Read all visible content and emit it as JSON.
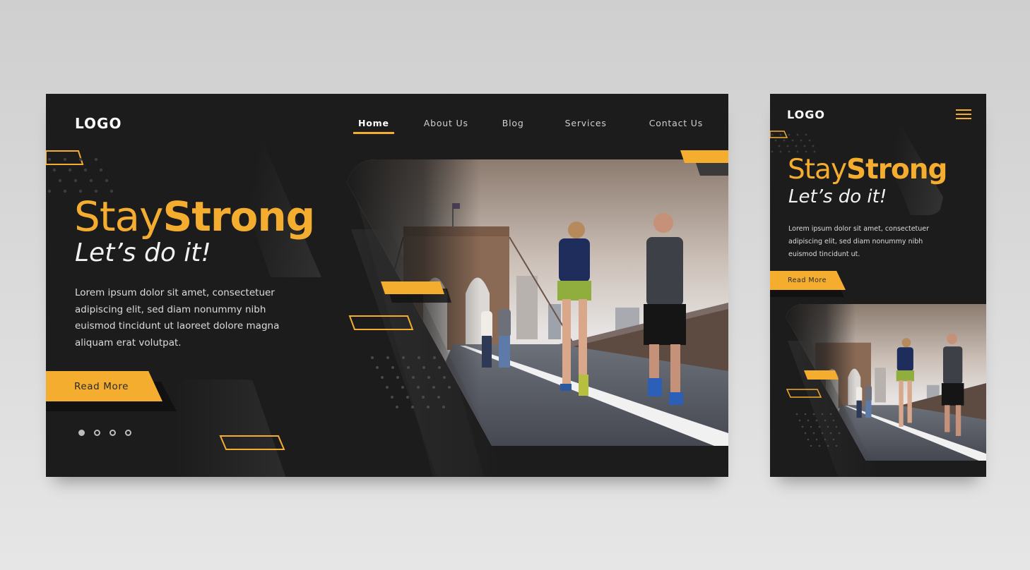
{
  "colors": {
    "accent": "#f5ad30",
    "panel_bg": "#1c1c1c",
    "canvas_bg": "#d8d8d8",
    "text_light": "#dcdcdc"
  },
  "desktop": {
    "logo": "LOGO",
    "nav": [
      {
        "label": "Home",
        "active": true
      },
      {
        "label": "About Us",
        "active": false
      },
      {
        "label": "Blog",
        "active": false
      },
      {
        "label": "Services",
        "active": false
      },
      {
        "label": "Contact Us",
        "active": false
      }
    ],
    "hero": {
      "title_light": "Stay",
      "title_bold": "Strong",
      "subtitle": "Let’s do it!",
      "body_lines": [
        "Lorem ipsum dolor sit amet, consectetuer",
        "adipiscing elit, sed diam nonummy nibh",
        "euismod tincidunt ut laoreet dolore magna",
        "aliquam erat volutpat."
      ],
      "button_label": "Read More"
    },
    "pagination": {
      "count": 4,
      "active_index": 0
    },
    "photo": {
      "alt": "Joggers running on Brooklyn Bridge"
    }
  },
  "mobile": {
    "logo": "LOGO",
    "menu_icon": "hamburger-icon",
    "hero": {
      "title_light": "Stay",
      "title_bold": "Strong",
      "subtitle": "Let’s do it!",
      "body_lines": [
        "Lorem ipsum dolor sit amet, consectetuer",
        "adipiscing elit, sed diam nonummy nibh",
        "euismod tincidunt ut."
      ],
      "button_label": "Read More"
    },
    "photo": {
      "alt": "Joggers running on Brooklyn Bridge"
    }
  }
}
